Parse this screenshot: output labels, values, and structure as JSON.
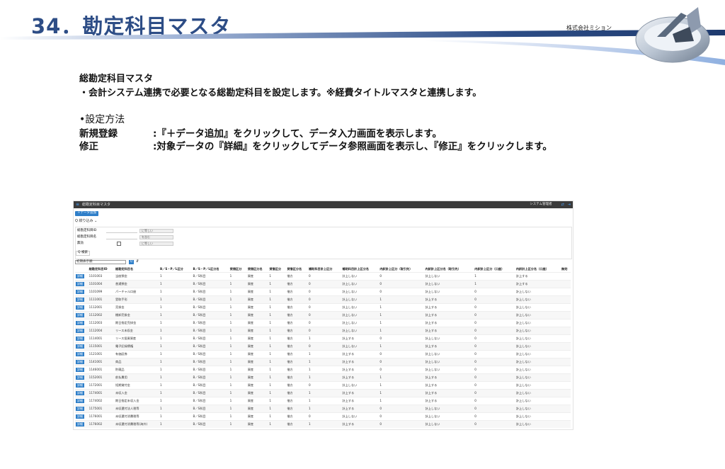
{
  "slide": {
    "title": "34．勘定科目マスタ",
    "company": "株式会社ミション",
    "section_title": "総勘定科目マスタ",
    "section_desc": "・会計システム連携で必要となる総勘定科目を設定します。※経費タイトルマスタと連携します。",
    "method_title": "•設定方法",
    "items": [
      {
        "label": "新規登録",
        "text": ":『＋データ追加』をクリックして、データ入力画面を表示します。"
      },
      {
        "label": "修正",
        "text": ":対象データの『詳細』をクリックしてデータ参照画面を表示し、『修正』をクリックします。"
      }
    ]
  },
  "screen": {
    "header": {
      "menu_icon": "≡",
      "title": "総勘定科目マスタ",
      "user": "システム管理者",
      "icon1": "⇄",
      "icon2": "⇥"
    },
    "add_button": "＋データ追加",
    "filter_toggle": "Q 絞り込み ⌄",
    "filters": [
      {
        "label": "総勘定科目ID",
        "op": "に等しい"
      },
      {
        "label": "総勘定科目名",
        "op": "を含む"
      },
      {
        "label": "無効",
        "op": "に等しい"
      }
    ],
    "search_button": "Q 検索",
    "view_select": "初期表示順",
    "view_button": "Q",
    "view_icon": "⇵",
    "columns": [
      "",
      "総勘定科目ID",
      "総勘定科目名",
      "B／S・P／L区分",
      "B／S・P／L区分名",
      "貸借区分",
      "貸借区分名",
      "貸借区分",
      "貸借区分名",
      "補助科目計上区分",
      "補助科目計上区分名",
      "内訳計上区分（取引先）",
      "内訳計上区分名（取引先）",
      "内訳計上区分（口座）",
      "内訳計上区分名（口座）",
      "無効"
    ],
    "detail_label": "詳細",
    "rows": [
      [
        "1101003",
        "当座預金",
        "1",
        "B／S科目",
        "1",
        "資産",
        "1",
        "借方",
        "0",
        "計上しない",
        "0",
        "計上しない",
        "1",
        "計上する",
        ""
      ],
      [
        "1101004",
        "普通預金",
        "1",
        "B／S科目",
        "1",
        "資産",
        "1",
        "借方",
        "0",
        "計上しない",
        "0",
        "計上しない",
        "1",
        "計上する",
        ""
      ],
      [
        "1101099",
        "パーチャル口座",
        "1",
        "B／S科目",
        "1",
        "資産",
        "1",
        "借方",
        "0",
        "計上しない",
        "0",
        "計上しない",
        "0",
        "計上しない",
        ""
      ],
      [
        "1111001",
        "受取手形",
        "1",
        "B／S科目",
        "1",
        "資産",
        "1",
        "借方",
        "0",
        "計上しない",
        "1",
        "計上する",
        "0",
        "計上しない",
        ""
      ],
      [
        "1112001",
        "売掛金",
        "1",
        "B／S科目",
        "1",
        "資産",
        "1",
        "借方",
        "0",
        "計上しない",
        "1",
        "計上する",
        "0",
        "計上しない",
        ""
      ],
      [
        "1112002",
        "棚卸売掛金",
        "1",
        "B／S科目",
        "1",
        "資産",
        "1",
        "借方",
        "0",
        "計上しない",
        "1",
        "計上する",
        "0",
        "計上しない",
        ""
      ],
      [
        "1112003",
        "期日指定売掛金",
        "1",
        "B／S科目",
        "1",
        "資産",
        "1",
        "借方",
        "0",
        "計上しない",
        "1",
        "計上する",
        "0",
        "計上しない",
        ""
      ],
      [
        "1112004",
        "リース未収金",
        "1",
        "B／S科目",
        "1",
        "資産",
        "1",
        "借方",
        "0",
        "計上しない",
        "1",
        "計上する",
        "0",
        "計上しない",
        ""
      ],
      [
        "1114001",
        "リース投資資産",
        "1",
        "B／S科目",
        "1",
        "資産",
        "1",
        "借方",
        "1",
        "計上する",
        "0",
        "計上しない",
        "0",
        "計上しない",
        ""
      ],
      [
        "1115001",
        "電子記録債権",
        "1",
        "B／S科目",
        "1",
        "資産",
        "1",
        "借方",
        "0",
        "計上しない",
        "1",
        "計上する",
        "0",
        "計上しない",
        ""
      ],
      [
        "1121001",
        "有価証券",
        "1",
        "B／S科目",
        "1",
        "資産",
        "1",
        "借方",
        "1",
        "計上する",
        "0",
        "計上しない",
        "0",
        "計上しない",
        ""
      ],
      [
        "1141001",
        "商品",
        "1",
        "B／S科目",
        "1",
        "資産",
        "1",
        "借方",
        "1",
        "計上する",
        "0",
        "計上しない",
        "0",
        "計上しない",
        ""
      ],
      [
        "1146001",
        "貯蔵品",
        "1",
        "B／S科目",
        "1",
        "資産",
        "1",
        "借方",
        "1",
        "計上する",
        "0",
        "計上しない",
        "0",
        "計上しない",
        ""
      ],
      [
        "1152001",
        "前払費用",
        "1",
        "B／S科目",
        "1",
        "資産",
        "1",
        "借方",
        "1",
        "計上する",
        "1",
        "計上する",
        "0",
        "計上しない",
        ""
      ],
      [
        "1172001",
        "短期貸付金",
        "1",
        "B／S科目",
        "1",
        "資産",
        "1",
        "借方",
        "0",
        "計上しない",
        "1",
        "計上する",
        "0",
        "計上しない",
        ""
      ],
      [
        "1174001",
        "未収入金",
        "1",
        "B／S科目",
        "1",
        "資産",
        "1",
        "借方",
        "1",
        "計上する",
        "1",
        "計上する",
        "0",
        "計上しない",
        ""
      ],
      [
        "1174002",
        "期日指定未収入金",
        "1",
        "B／S科目",
        "1",
        "資産",
        "1",
        "借方",
        "1",
        "計上する",
        "1",
        "計上する",
        "0",
        "計上しない",
        ""
      ],
      [
        "1175001",
        "未収還付法人税等",
        "1",
        "B／S科目",
        "1",
        "資産",
        "1",
        "借方",
        "1",
        "計上する",
        "0",
        "計上しない",
        "0",
        "計上しない",
        ""
      ],
      [
        "1176001",
        "未収還付消費税等",
        "1",
        "B／S科目",
        "1",
        "資産",
        "1",
        "借方",
        "0",
        "計上しない",
        "0",
        "計上しない",
        "0",
        "計上しない",
        ""
      ],
      [
        "1176002",
        "未収還付消費税等(海外)",
        "1",
        "B／S科目",
        "1",
        "資産",
        "1",
        "借方",
        "1",
        "計上する",
        "0",
        "計上しない",
        "0",
        "計上しない",
        ""
      ]
    ]
  }
}
